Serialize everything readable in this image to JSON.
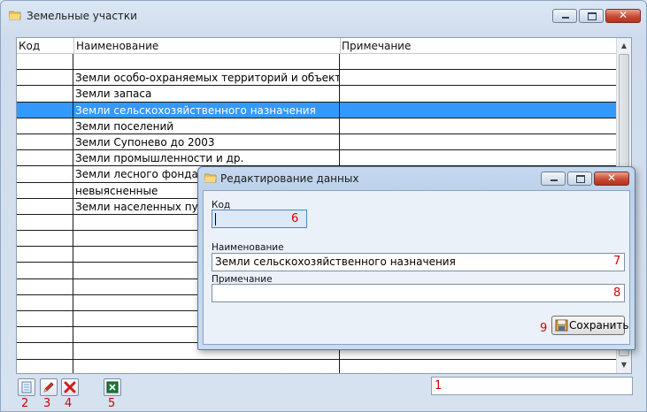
{
  "main_window": {
    "title": "Земельные участки",
    "columns": [
      "Код",
      "Наименование",
      "Примечание"
    ],
    "rows": [
      {
        "code": "",
        "name": "",
        "note": ""
      },
      {
        "code": "",
        "name": "Земли особо-охраняемых территорий и объектов",
        "note": ""
      },
      {
        "code": "",
        "name": "Земли запаса",
        "note": ""
      },
      {
        "code": "",
        "name": "Земли сельскохозяйственного назначения",
        "note": "",
        "selected": true
      },
      {
        "code": "",
        "name": "Земли поселений",
        "note": ""
      },
      {
        "code": "",
        "name": "Земли Супонево до 2003",
        "note": ""
      },
      {
        "code": "",
        "name": "Земли промышленности и др.",
        "note": ""
      },
      {
        "code": "",
        "name": "Земли лесного фонда",
        "note": ""
      },
      {
        "code": "",
        "name": "невыясненные",
        "note": ""
      },
      {
        "code": "",
        "name": "Земли населенных пунктов",
        "note": ""
      },
      {
        "code": "",
        "name": "",
        "note": ""
      },
      {
        "code": "",
        "name": "",
        "note": ""
      },
      {
        "code": "",
        "name": "",
        "note": ""
      },
      {
        "code": "",
        "name": "",
        "note": ""
      },
      {
        "code": "",
        "name": "",
        "note": ""
      },
      {
        "code": "",
        "name": "",
        "note": ""
      },
      {
        "code": "",
        "name": "",
        "note": ""
      },
      {
        "code": "",
        "name": "",
        "note": ""
      },
      {
        "code": "",
        "name": "",
        "note": ""
      },
      {
        "code": "",
        "name": "",
        "note": ""
      }
    ],
    "status_value": ""
  },
  "toolbar": {
    "buttons": [
      {
        "name": "new-record-button",
        "icon": "document-icon"
      },
      {
        "name": "edit-record-button",
        "icon": "pencil-icon"
      },
      {
        "name": "delete-record-button",
        "icon": "red-x-icon"
      },
      {
        "name": "export-excel-button",
        "icon": "excel-icon"
      }
    ]
  },
  "dialog": {
    "title": "Редактирование данных",
    "code_label": "Код",
    "code_value": "",
    "name_label": "Наименование",
    "name_value": "Земли сельскохозяйственного назначения",
    "note_label": "Примечание",
    "note_value": "",
    "save_label": "Сохранить"
  },
  "annotations": [
    "1",
    "2",
    "3",
    "4",
    "5",
    "6",
    "7",
    "8",
    "9"
  ],
  "colors": {
    "selection": "#3399ff",
    "annotation": "#d40000",
    "close_button": "#c74b35"
  }
}
